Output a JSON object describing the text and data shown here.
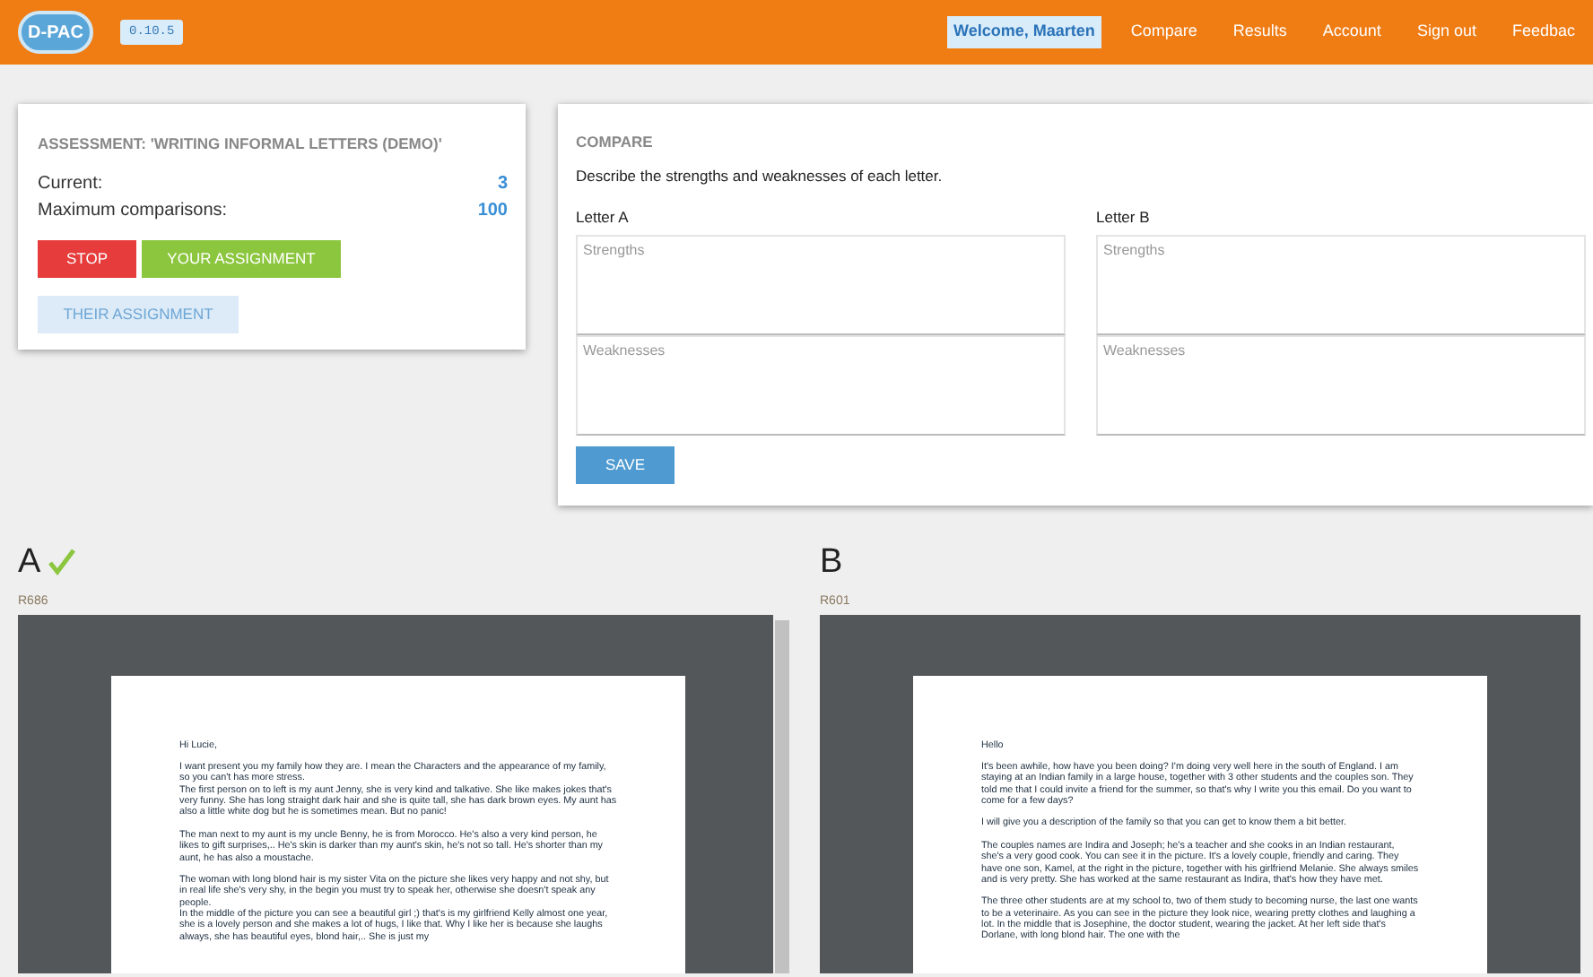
{
  "navbar": {
    "logo": "D-PAC",
    "version": "0.10.5",
    "welcome": "Welcome, Maarten",
    "links": [
      "Compare",
      "Results",
      "Account",
      "Sign out",
      "Feedbac"
    ]
  },
  "assessment": {
    "title": "ASSESSMENT: 'WRITING INFORMAL LETTERS (DEMO)'",
    "stats": [
      {
        "label": "Current:",
        "value": "3"
      },
      {
        "label": "Maximum comparisons:",
        "value": "100"
      }
    ],
    "buttons": [
      {
        "label": "STOP",
        "kind": "danger"
      },
      {
        "label": "YOUR ASSIGNMENT",
        "kind": "success"
      },
      {
        "label": "THEIR ASSIGNMENT",
        "kind": "light"
      }
    ]
  },
  "compare": {
    "heading": "COMPARE",
    "instruction": "Describe the strengths and weaknesses of each letter.",
    "letters": [
      {
        "label": "Letter A",
        "fields": [
          {
            "placeholder": "Strengths"
          },
          {
            "placeholder": "Weaknesses"
          }
        ]
      },
      {
        "label": "Letter B",
        "fields": [
          {
            "placeholder": "Strengths"
          },
          {
            "placeholder": "Weaknesses"
          }
        ]
      }
    ],
    "save": "SAVE"
  },
  "documents": [
    {
      "heading": "A",
      "chosen": true,
      "code": "R686",
      "blocks": [
        [
          "Hi Lucie,"
        ],
        [
          "I want present you my family how they are. I mean the Characters and the appearance of my family, so you can't has more stress.",
          "The first person on to left is my aunt Jenny, she is very kind and talkative. She like makes jokes that's very funny. She has long straight dark hair and she is quite tall, she has dark brown eyes. My aunt has also a little white dog but he is sometimes mean. But no panic!"
        ],
        [
          "The man next to my aunt is my uncle Benny, he is from Morocco. He's also a very kind person, he likes to gift surprises,.. He's skin is darker than my aunt's skin, he's not so tall. He's shorter than my aunt, he has also a moustache."
        ],
        [
          "The woman with long blond hair is my sister Vita on the picture she likes very happy and not shy, but in real life she's very shy, in the begin you must try to speak her, otherwise she doesn't speak any people.",
          "In the middle of the picture you can see a beautiful girl ;) that's is my girlfriend Kelly almost one year, she is a lovely person and she makes a lot of hugs, I like that. Why I like her is because she laughs always, she has beautiful eyes, blond hair,.. She is just my"
        ]
      ]
    },
    {
      "heading": "B",
      "chosen": false,
      "code": "R601",
      "blocks": [
        [
          "Hello"
        ],
        [
          "It's been awhile, how have you been doing? I'm doing very well here in the south of England. I am staying at an Indian family in a large house, together with 3 other students and the couples son. They told me that I could invite a friend for the summer, so that's why I write you this email. Do you want to come for a few days?"
        ],
        [
          "I will give you a description of the family so that you can get to know them a bit better."
        ],
        [
          "The couples names are Indira and Joseph; he's a teacher and she cooks in an Indian restaurant, she's a very good cook. You can see it in the picture. It's a lovely couple, friendly and caring. They have one son, Kamel, at the right in the picture, together with his girlfriend Melanie. She always smiles and is very pretty. She has worked at the same restaurant as Indira, that's how they have met."
        ],
        [
          "The three other students are at my school to, two of them study to becoming nurse, the last one wants to be a veterinaire. As you can see in the picture they look nice, wearing pretty clothes and laughing a lot. In the middle that is Josephine, the doctor student, wearing the jacket. At her left side that's Dorlane, with long blond hair. The one with the"
        ]
      ]
    }
  ]
}
